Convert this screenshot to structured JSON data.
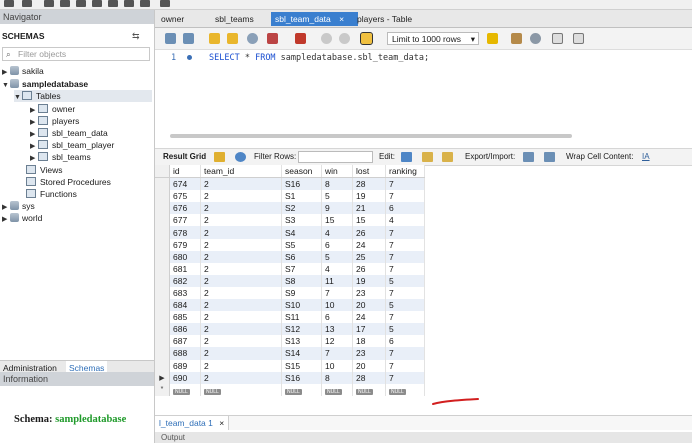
{
  "navigator": {
    "title": "Navigator",
    "schemas_title": "SCHEMAS",
    "filter_placeholder": "Filter objects",
    "tree": {
      "sakila": "sakila",
      "sampledatabase": "sampledatabase",
      "tables": "Tables",
      "owner": "owner",
      "players": "players",
      "sbl_team_data": "sbl_team_data",
      "sbl_team_player": "sbl_team_player",
      "sbl_teams": "sbl_teams",
      "views": "Views",
      "stored_procedures": "Stored Procedures",
      "functions": "Functions",
      "sys": "sys",
      "world": "world"
    },
    "bottom_tabs": [
      "Administration",
      "Schemas"
    ],
    "info_title": "Information",
    "schema_label": "Schema:",
    "schema_value": "sampledatabase"
  },
  "tabs": [
    "owner",
    "sbl_teams",
    "sbl_team_data",
    "players - Table"
  ],
  "active_tab_close": "×",
  "editor": {
    "limit_label": "Limit to 1000 rows",
    "line_number": "1",
    "sql_keyword1": "SELECT",
    "sql_rest1": " * ",
    "sql_keyword2": "FROM",
    "sql_rest2": " sampledatabase.sbl_team_data;"
  },
  "result_toolbar": {
    "result_grid": "Result Grid",
    "filter_rows": "Filter Rows:",
    "edit": "Edit:",
    "export_import": "Export/Import:",
    "wrap_cell": "Wrap Cell Content:"
  },
  "grid": {
    "columns": [
      "id",
      "team_id",
      "season",
      "win",
      "lost",
      "ranking"
    ],
    "rows": [
      [
        "674",
        "2",
        "S16",
        "8",
        "28",
        "7"
      ],
      [
        "675",
        "2",
        "S1",
        "5",
        "19",
        "7"
      ],
      [
        "676",
        "2",
        "S2",
        "9",
        "21",
        "6"
      ],
      [
        "677",
        "2",
        "S3",
        "15",
        "15",
        "4"
      ],
      [
        "678",
        "2",
        "S4",
        "4",
        "26",
        "7"
      ],
      [
        "679",
        "2",
        "S5",
        "6",
        "24",
        "7"
      ],
      [
        "680",
        "2",
        "S6",
        "5",
        "25",
        "7"
      ],
      [
        "681",
        "2",
        "S7",
        "4",
        "26",
        "7"
      ],
      [
        "682",
        "2",
        "S8",
        "11",
        "19",
        "5"
      ],
      [
        "683",
        "2",
        "S9",
        "7",
        "23",
        "7"
      ],
      [
        "684",
        "2",
        "S10",
        "10",
        "20",
        "5"
      ],
      [
        "685",
        "2",
        "S11",
        "6",
        "24",
        "7"
      ],
      [
        "686",
        "2",
        "S12",
        "13",
        "17",
        "5"
      ],
      [
        "687",
        "2",
        "S13",
        "12",
        "18",
        "6"
      ],
      [
        "688",
        "2",
        "S14",
        "7",
        "23",
        "7"
      ],
      [
        "689",
        "2",
        "S15",
        "10",
        "20",
        "7"
      ],
      [
        "690",
        "2",
        "S16",
        "8",
        "28",
        "7"
      ]
    ],
    "null_label": "NULL"
  },
  "result_tab": "l_team_data 1",
  "result_tab_close": "×",
  "output_label": "Output",
  "colors": {
    "active_tab": "#3a7fcf",
    "annotation": "#d21f1f",
    "schema_value": "#1f9a2a"
  }
}
